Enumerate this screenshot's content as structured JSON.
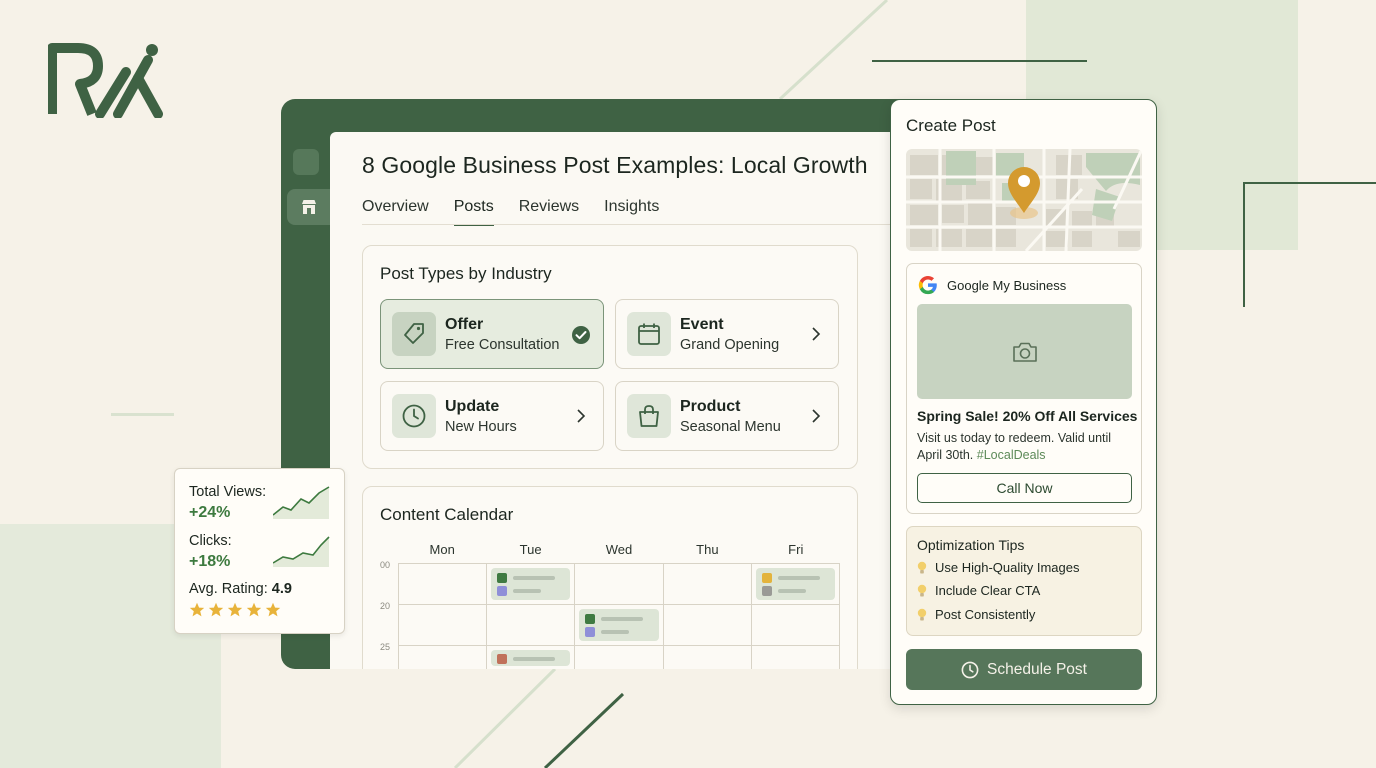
{
  "brand": {
    "logo_text": "RX",
    "accent": "#3f6244"
  },
  "page": {
    "title": "8 Google Business Post Examples: Local Growth",
    "tabs": [
      "Overview",
      "Posts",
      "Reviews",
      "Insights"
    ],
    "active_tab": "Posts"
  },
  "rail": {
    "items": [
      {
        "icon": "square-icon"
      },
      {
        "icon": "store-icon",
        "active": true
      }
    ]
  },
  "post_types": {
    "title": "Post Types by Industry",
    "items": [
      {
        "type": "Offer",
        "example": "Free Consultation",
        "icon": "tag-icon",
        "selected": true
      },
      {
        "type": "Event",
        "example": "Grand Opening",
        "icon": "calendar-icon",
        "selected": false
      },
      {
        "type": "Update",
        "example": "New Hours",
        "icon": "clock-icon",
        "selected": false
      },
      {
        "type": "Product",
        "example": "Seasonal Menu",
        "icon": "shopping-bag-icon",
        "selected": false
      }
    ]
  },
  "calendar": {
    "title": "Content Calendar",
    "days": [
      "Mon",
      "Tue",
      "Wed",
      "Thu",
      "Fri"
    ],
    "row_labels": [
      "00",
      "20",
      "25"
    ]
  },
  "metrics": {
    "views_label": "Total Views:",
    "views_value": "+24%",
    "clicks_label": "Clicks:",
    "clicks_value": "+18%",
    "rating_label": "Avg. Rating:",
    "rating_value": "4.9",
    "stars": 5
  },
  "create_post": {
    "title": "Create Post",
    "platform": "Google My Business",
    "headline": "Spring Sale! 20% Off All Services",
    "body": "Visit us today to redeem. Valid until April 30th.",
    "hashtag": "#LocalDeals",
    "cta": "Call Now",
    "tips_title": "Optimization Tips",
    "tips": [
      "Use High-Quality Images",
      "Include Clear CTA",
      "Post Consistently"
    ],
    "schedule_label": "Schedule Post"
  }
}
